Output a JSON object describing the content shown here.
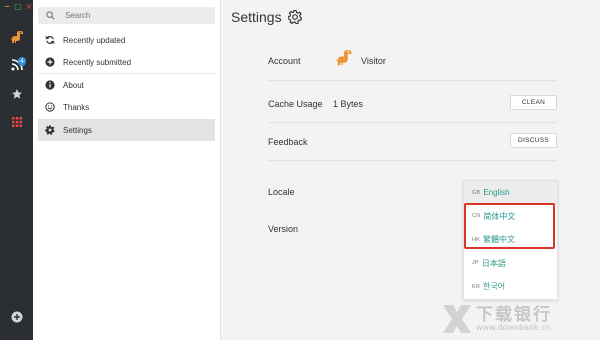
{
  "window": {
    "controls": [
      "−",
      "□",
      "×"
    ]
  },
  "rail": {
    "badge_count": "4"
  },
  "sidebar": {
    "search_placeholder": "Search",
    "items": [
      {
        "label": "Recently updated",
        "icon": "refresh-icon"
      },
      {
        "label": "Recently submitted",
        "icon": "plus-circle-icon"
      },
      {
        "label": "About",
        "icon": "info-icon"
      },
      {
        "label": "Thanks",
        "icon": "smile-icon"
      },
      {
        "label": "Settings",
        "icon": "gear-icon",
        "active": true
      }
    ]
  },
  "settings": {
    "title": "Settings",
    "account_label": "Account",
    "account_value": "Visitor",
    "cache_label": "Cache Usage",
    "cache_value": "1 Bytes",
    "clean_button": "CLEAN",
    "feedback_label": "Feedback",
    "discuss_button": "DISCUSS",
    "locale_label": "Locale",
    "version_label": "Version"
  },
  "locale_options": [
    {
      "code": "GB",
      "label": "English",
      "selected": true
    },
    {
      "code": "CN",
      "label": "简体中文",
      "highlighted": true
    },
    {
      "code": "HK",
      "label": "繁體中文",
      "highlighted": true
    },
    {
      "code": "JP",
      "label": "日本語"
    },
    {
      "code": "KR",
      "label": "한국어"
    }
  ],
  "watermark": {
    "name": "下载银行",
    "url": "www.downbank.cn"
  },
  "colors": {
    "rail_bg": "#2b2f33",
    "accent_orange": "#e8953a",
    "locale_text": "#2b9a8a",
    "highlight_red": "#d9342b",
    "badge_blue": "#3a8fd6"
  }
}
